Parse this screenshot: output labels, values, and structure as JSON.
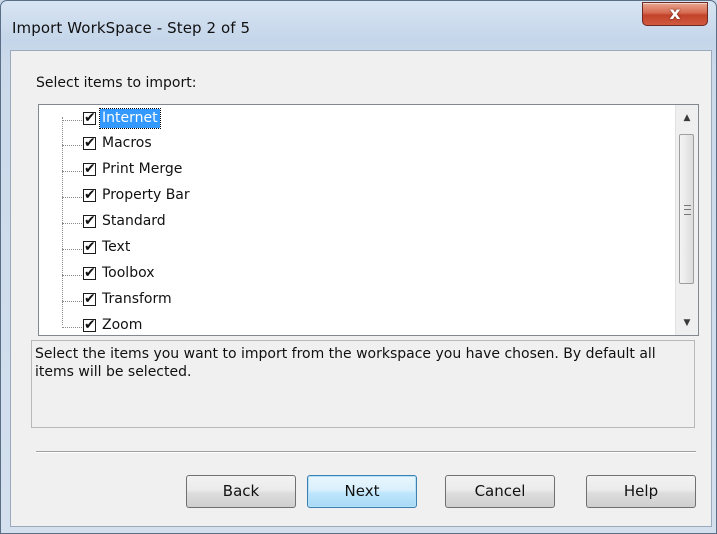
{
  "window": {
    "title": "Import WorkSpace - Step 2 of 5",
    "close_glyph": "x"
  },
  "prompt": "Select items to import:",
  "tree": {
    "items": [
      {
        "label": "Internet",
        "checked": true,
        "selected": true
      },
      {
        "label": "Macros",
        "checked": true,
        "selected": false
      },
      {
        "label": "Print Merge",
        "checked": true,
        "selected": false
      },
      {
        "label": "Property Bar",
        "checked": true,
        "selected": false
      },
      {
        "label": "Standard",
        "checked": true,
        "selected": false
      },
      {
        "label": "Text",
        "checked": true,
        "selected": false
      },
      {
        "label": "Toolbox",
        "checked": true,
        "selected": false
      },
      {
        "label": "Transform",
        "checked": true,
        "selected": false
      },
      {
        "label": "Zoom",
        "checked": true,
        "selected": false
      }
    ],
    "check_glyph": "✔"
  },
  "description": "Select the items you want to import from the workspace you have chosen. By default all items will be selected.",
  "buttons": {
    "back": "Back",
    "next": "Next",
    "cancel": "Cancel",
    "help": "Help"
  },
  "colors": {
    "selection": "#3399ff",
    "close_button": "#c2432a",
    "default_button_border": "#3c7fb1"
  }
}
